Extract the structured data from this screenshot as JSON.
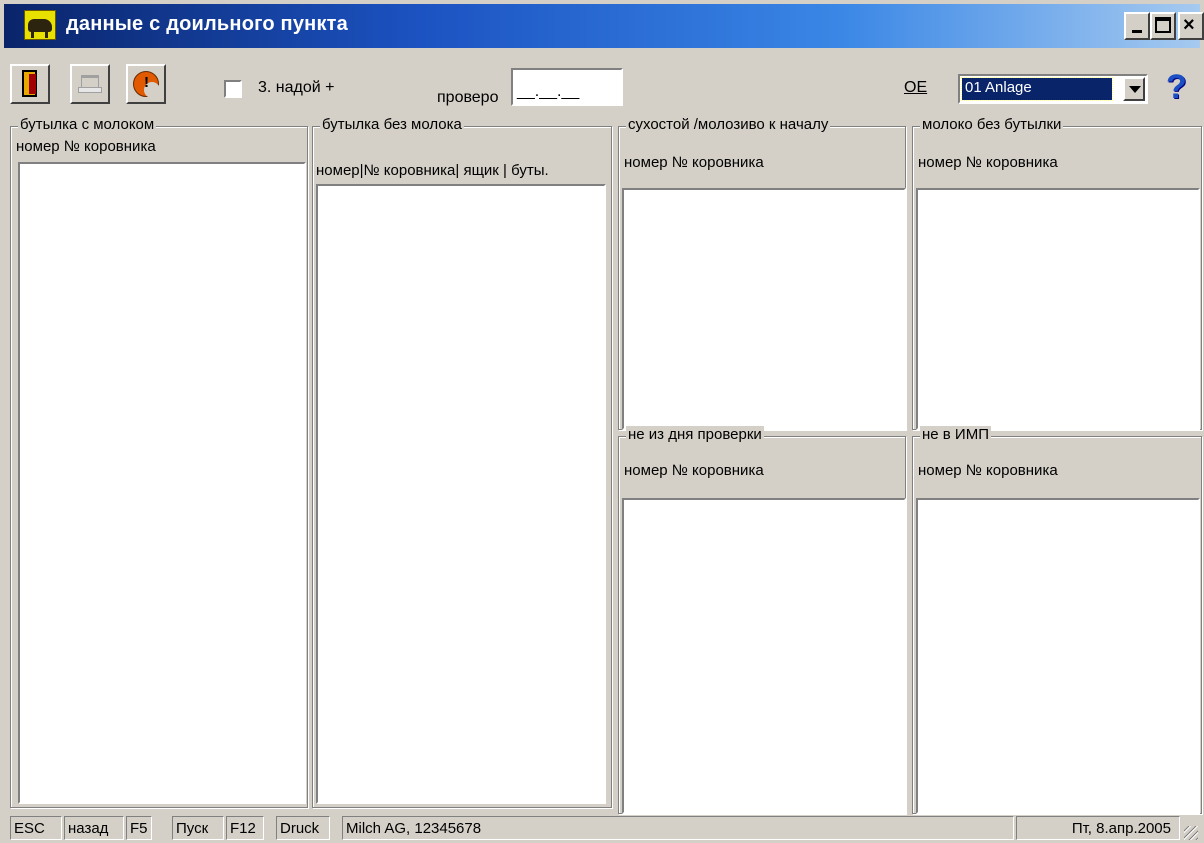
{
  "window": {
    "title": "данные с доильного пункта",
    "close_glyph": "×"
  },
  "toolbar": {
    "checkbox_label": "3. надой +",
    "checkbox_checked": false,
    "check_label": "проверо",
    "check_value": "__.__.__",
    "oe_label": "OE",
    "oe_value": "01 Anlage",
    "help_glyph": "?"
  },
  "icons": {
    "exit": "exit-door-icon",
    "print": "printer-icon",
    "refresh": "refresh-icon",
    "help": "help-icon"
  },
  "panels": {
    "with_milk": {
      "caption": "бутылка с молоком",
      "header": "номер № коровника"
    },
    "without_milk": {
      "caption": "бутылка без молока",
      "header": "номер|№ коровника| ящик | буты."
    },
    "dry": {
      "caption": "сухостой /молозиво к началу",
      "header": "номер № коровника"
    },
    "no_bottle": {
      "caption": "молоко без бутылки",
      "header": "номер № коровника"
    },
    "not_check_day": {
      "caption": "не из дня проверки",
      "header": "номер № коровника"
    },
    "not_imp": {
      "caption": "не в ИМП",
      "header": "номер № коровника"
    }
  },
  "statusbar": {
    "esc_key": "ESC",
    "esc_label": "назад",
    "f5_key": "F5",
    "f5_label": "Пуск",
    "f12_key": "F12",
    "f12_label": "Druck",
    "company": "Milch AG, 12345678",
    "date": "Пт, 8.апр.2005"
  },
  "colors": {
    "title_start": "#0a246a",
    "title_end": "#a6caf0",
    "window_face": "#d4d0c8",
    "selection": "#0a246a"
  }
}
